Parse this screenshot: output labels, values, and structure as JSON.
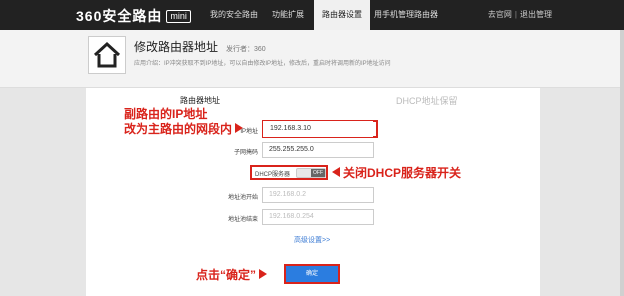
{
  "topbar": {
    "logo_text": "360安全路由",
    "logo_badge": "mini",
    "tabs": [
      {
        "label": "我的安全路由"
      },
      {
        "label": "功能扩展"
      },
      {
        "label": "路由器设置"
      },
      {
        "label": "用手机管理路由器"
      }
    ],
    "links": {
      "official": "去官网",
      "sep": "|",
      "logout": "退出管理"
    }
  },
  "header": {
    "title": "修改路由器地址",
    "publisher": "发行者：360",
    "description": "应用介绍：IP冲突获取不到IP地址，可以自由修改IP地址，修改后，重启时将调用新的IP地址访问"
  },
  "panel": {
    "tab_lan": "路由器地址",
    "tab_dhcp": "DHCP地址保留",
    "fields": {
      "ip_label": "IP地址",
      "ip_value": "192.168.3.10",
      "mask_label": "子网掩码",
      "mask_value": "255.255.255.0",
      "dhcp_label": "DHCP服务器",
      "dhcp_state": "OFF",
      "start_label": "地址池开始",
      "start_placeholder": "192.168.0.2",
      "end_label": "地址池结束",
      "end_placeholder": "192.168.0.254"
    },
    "advanced_link": "高级设置>>",
    "confirm_button": "确定"
  },
  "annotations": {
    "ip_note_line1": "副路由的IP地址",
    "ip_note_line2": "改为主路由的网段内",
    "dhcp_note": "关闭DHCP服务器开关",
    "confirm_note": "点击“确定”",
    "color": "#d9231b"
  },
  "colors": {
    "topbar": "#222222",
    "accent_blue": "#2b7de0",
    "link_blue": "#3b7bd4"
  }
}
